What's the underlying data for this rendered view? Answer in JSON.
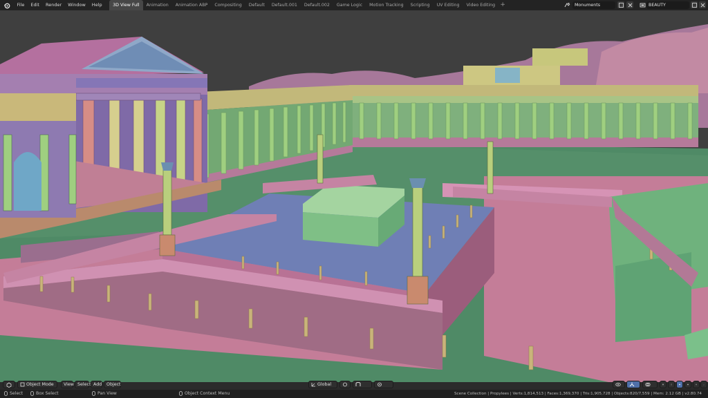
{
  "menu": [
    "File",
    "Edit",
    "Render",
    "Window",
    "Help"
  ],
  "tabs": [
    {
      "label": "3D View Full",
      "active": true
    },
    {
      "label": "Animation",
      "active": false
    },
    {
      "label": "Animation ABP",
      "active": false
    },
    {
      "label": "Compositing",
      "active": false
    },
    {
      "label": "Default",
      "active": false
    },
    {
      "label": "Default.001",
      "active": false
    },
    {
      "label": "Default.002",
      "active": false
    },
    {
      "label": "Game Logic",
      "active": false
    },
    {
      "label": "Motion Tracking",
      "active": false
    },
    {
      "label": "Scripting",
      "active": false
    },
    {
      "label": "UV Editing",
      "active": false
    },
    {
      "label": "Video Editing",
      "active": false
    }
  ],
  "add_tab": "+",
  "scene": {
    "name": "Monuments"
  },
  "view_layer": {
    "name": "BEAUTY"
  },
  "viewport_header": {
    "mode": "Object Mode",
    "view": "View",
    "select": "Select",
    "add": "Add",
    "object": "Object",
    "transform_orientation": "Global"
  },
  "status_bar": {
    "select": "Select",
    "box_select": "Box Select",
    "pan_view": "Pan View",
    "context_menu": "Object Context Menu",
    "stats": "Scene Collection | Propylees | Verts:1,814,513 | Faces:1,369,370 | Tris:1,905,728 | Objects:820/7,559 | Mem: 2.12 GB | v2.80.74"
  },
  "colors": {
    "ground": "#4f8a66",
    "pink": "#b77a9a",
    "green": "#8cc07e",
    "purple": "#8f6fb2",
    "lavender": "#6f7fb5",
    "yellow": "#c9c97a",
    "orange": "#c98a6e"
  }
}
